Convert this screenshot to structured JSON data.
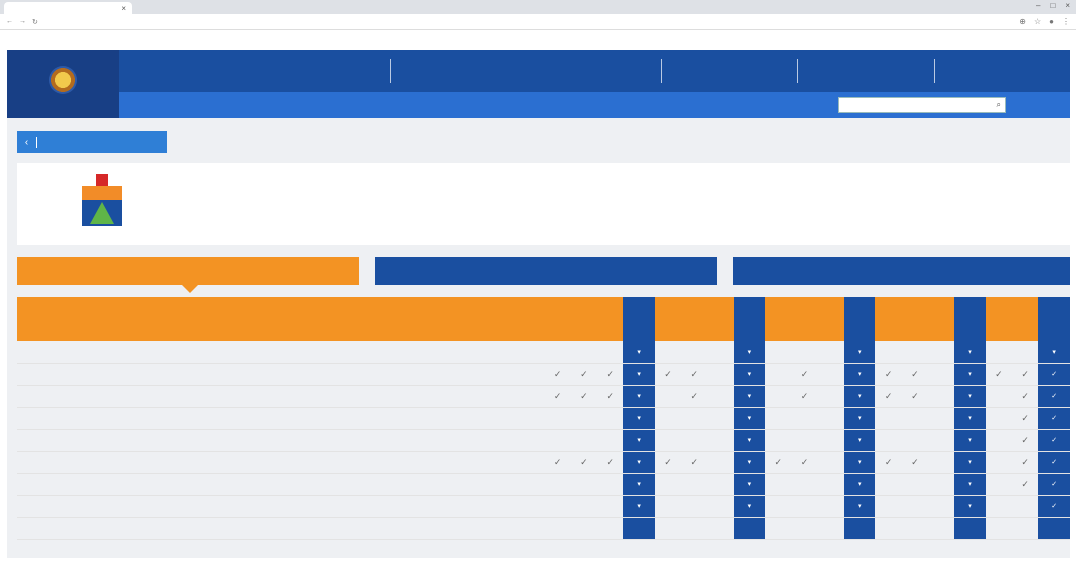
{
  "browser": {
    "tab_title": "",
    "url": ""
  },
  "header": {
    "logo_text": "",
    "menu": [
      "",
      "",
      "",
      "",
      "",
      "",
      "",
      ""
    ],
    "search_placeholder": "",
    "buttons": [
      "",
      ""
    ]
  },
  "back_label": "",
  "company": {
    "name": "",
    "email": "",
    "rows": [
      {
        "label": "",
        "value": ""
      },
      {
        "label": "",
        "value": ""
      }
    ],
    "status": ""
  },
  "tabs": [
    "",
    "",
    ""
  ],
  "table": {
    "headers": [
      "",
      "",
      "",
      "",
      "",
      "",
      "",
      "",
      "",
      "",
      "",
      "",
      "",
      "",
      "",
      "",
      "",
      "",
      "",
      "",
      ""
    ],
    "blue_cols": [
      4,
      8,
      12,
      16,
      19
    ],
    "rows": [
      {
        "idx": "",
        "name": "",
        "cells": [
          "",
          "",
          "",
          "▾",
          "",
          "",
          "",
          "▾",
          "",
          "",
          "",
          "▾",
          "",
          "",
          "",
          "▾",
          "",
          "",
          "▾"
        ]
      },
      {
        "idx": "",
        "name": "",
        "cells": [
          "✓",
          "✓",
          "✓",
          "▾",
          "✓",
          "✓",
          "",
          "▾",
          "",
          "✓",
          "",
          "▾",
          "✓",
          "✓",
          "",
          "▾",
          "✓",
          "✓",
          "✓"
        ]
      },
      {
        "idx": "",
        "name": "",
        "cells": [
          "✓",
          "✓",
          "✓",
          "▾",
          "",
          "✓",
          "",
          "▾",
          "",
          "✓",
          "",
          "▾",
          "✓",
          "✓",
          "",
          "▾",
          "",
          "✓",
          "✓"
        ]
      },
      {
        "idx": "",
        "name": "",
        "cells": [
          "",
          "",
          "",
          "▾",
          "",
          "",
          "",
          "▾",
          "",
          "",
          "",
          "▾",
          "",
          "",
          "",
          "▾",
          "",
          "✓",
          "✓"
        ]
      },
      {
        "idx": "",
        "name": "",
        "cells": [
          "",
          "",
          "",
          "▾",
          "",
          "",
          "",
          "▾",
          "",
          "",
          "",
          "▾",
          "",
          "",
          "",
          "▾",
          "",
          "✓",
          "✓"
        ]
      },
      {
        "idx": "",
        "name": "",
        "cells": [
          "✓",
          "✓",
          "✓",
          "▾",
          "✓",
          "✓",
          "",
          "▾",
          "✓",
          "✓",
          "",
          "▾",
          "✓",
          "✓",
          "",
          "▾",
          "",
          "✓",
          "✓"
        ]
      },
      {
        "idx": "",
        "name": "",
        "cells": [
          "",
          "",
          "",
          "▾",
          "",
          "",
          "",
          "▾",
          "",
          "",
          "",
          "▾",
          "",
          "",
          "",
          "▾",
          "",
          "✓",
          "✓"
        ]
      },
      {
        "idx": "",
        "name": "",
        "cells": [
          "",
          "",
          "",
          "▾",
          "",
          "",
          "",
          "▾",
          "",
          "",
          "",
          "▾",
          "",
          "",
          "",
          "▾",
          "",
          "",
          "✓"
        ]
      },
      {
        "idx": "",
        "name": "",
        "cells": [
          "",
          "",
          "",
          "",
          "",
          "",
          "",
          "",
          "",
          "",
          "",
          "",
          "",
          "",
          "",
          "",
          "",
          "",
          ""
        ]
      }
    ]
  }
}
